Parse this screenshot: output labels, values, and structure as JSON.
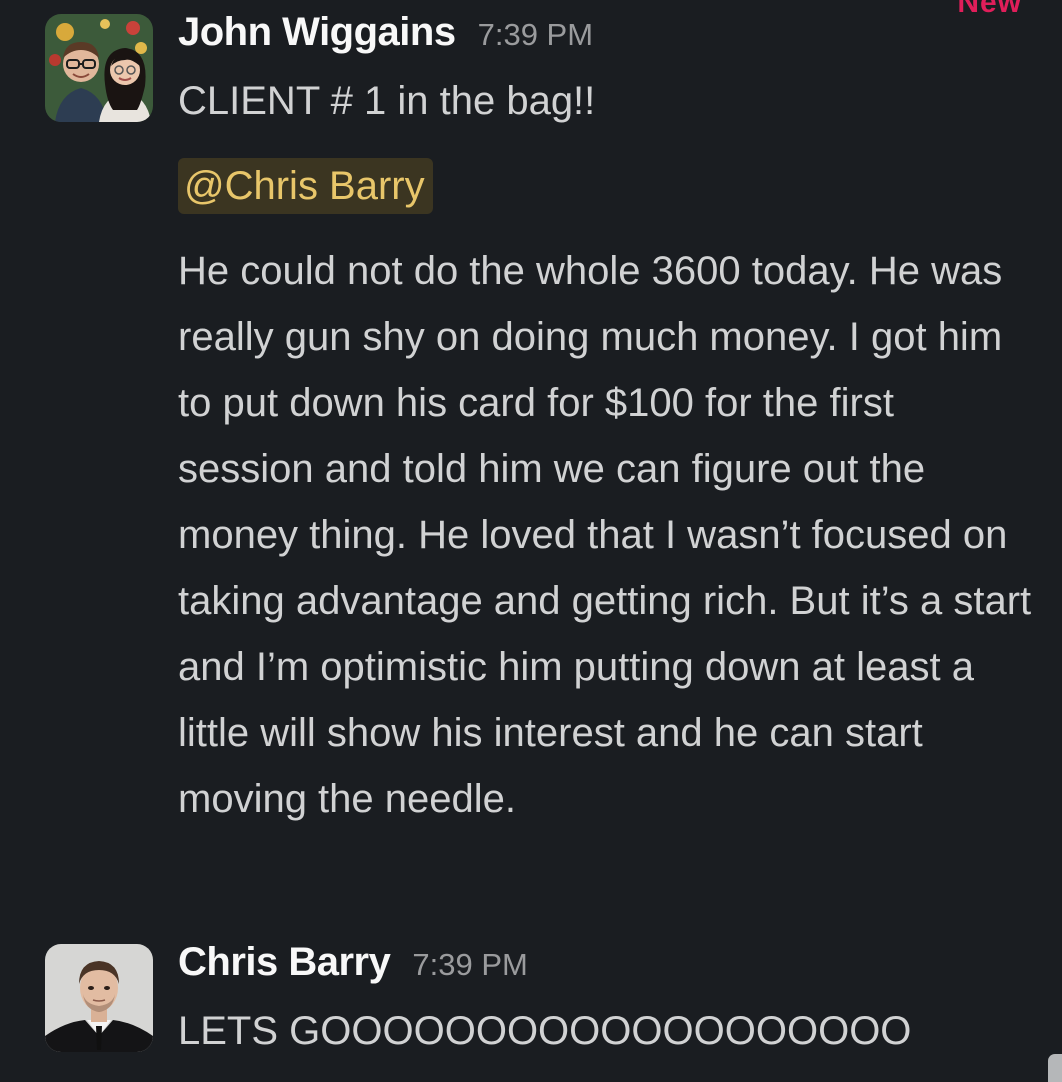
{
  "new_marker": "New",
  "messages": [
    {
      "sender": "John Wiggains",
      "timestamp": "7:39 PM",
      "avatar_icon": "couple-photo-avatar",
      "first_line": "CLIENT # 1 in the bag!!",
      "mention": "@Chris Barry",
      "paragraph": "He could not do the whole 3600 today. He was really gun shy on doing much money. I got him to put down his card for $100 for the first session and told him we can figure out the money thing. He loved that I wasn’t focused on taking advantage and getting rich. But it’s a start and I’m optimistic him putting down at least a little will show his interest and he can start moving the needle."
    },
    {
      "sender": "Chris Barry",
      "timestamp": "7:39 PM",
      "avatar_icon": "man-in-suit-avatar",
      "first_line": "LETS GOOOOOOOOOOOOOOOOOOO"
    }
  ],
  "colors": {
    "background": "#1a1d21",
    "text": "#d1d2d3",
    "sender": "#f8f8f8",
    "timestamp": "#9a9b9d",
    "mention_bg": "#3b3521",
    "mention_text": "#e8c66a",
    "new_marker": "#e01e5a"
  }
}
